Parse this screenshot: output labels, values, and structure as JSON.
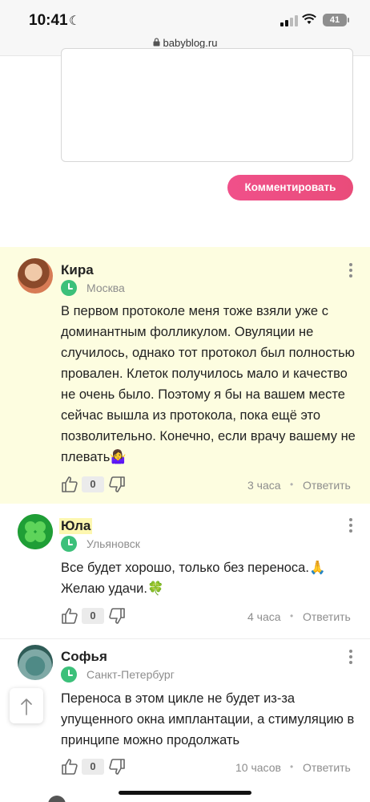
{
  "status_bar": {
    "time": "10:41",
    "battery": "41"
  },
  "browser": {
    "url": "babyblog.ru"
  },
  "compose": {
    "submit_label": "Комментировать"
  },
  "comments": [
    {
      "author": "Кира",
      "city": "Москва",
      "text": "В первом протоколе меня тоже взяли уже с доминантным фолликулом. Овуляции не случилось, однако тот протокол был полностью провален. Клеток получилось мало и качество не очень было. Поэтому я бы на вашем месте сейчас вышла из протокола, пока ещё это позволительно. Конечно, если врачу вашему не плевать🤷‍♀️",
      "likes": "0",
      "time_ago": "3 часа",
      "reply_label": "Ответить"
    },
    {
      "author": "Юла",
      "city": "Ульяновск",
      "text": "Все будет хорошо, только без переноса.🙏 Желаю удачи.🍀",
      "likes": "0",
      "time_ago": "4 часа",
      "reply_label": "Ответить"
    },
    {
      "author": "Софья",
      "city": "Санкт-Петербург",
      "text": "Переноса в этом цикле не будет из-за упущенного окна имплантации, а стимуляцию в принципе можно продолжать",
      "likes": "0",
      "time_ago": "10 часов",
      "reply_label": "Ответить"
    }
  ],
  "icons": {
    "lock": "lock-icon",
    "clock": "clock-icon",
    "like": "thumbs-up-icon",
    "dislike": "thumbs-down-icon",
    "menu": "more-vertical-icon",
    "scroll_top": "arrow-up-icon"
  },
  "colors": {
    "accent": "#ef4f86",
    "online_green": "#3cc07a",
    "highlight_bg": "#fdfde0"
  }
}
